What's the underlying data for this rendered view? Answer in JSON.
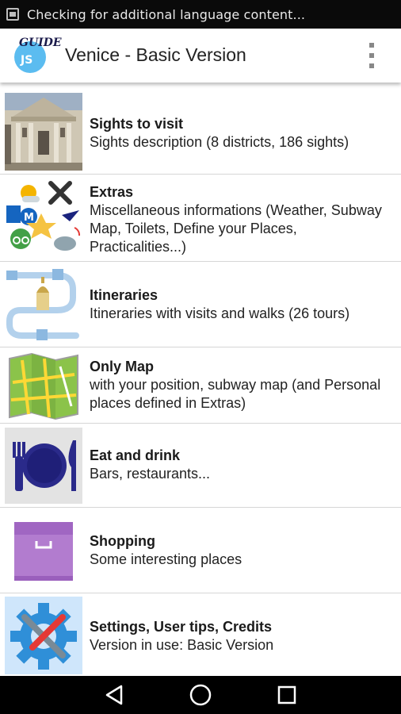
{
  "status_bar": {
    "notification_text": "Checking for additional language content..."
  },
  "app_bar": {
    "logo": {
      "top_text": "GUIDE",
      "bottom_text": "JS"
    },
    "title": "Venice - Basic Version",
    "menu_icon": "overflow-menu-icon"
  },
  "menu": {
    "items": [
      {
        "title": "Sights to visit",
        "desc": "Sights description (8 districts, 186 sights)",
        "icon": "palace-photo"
      },
      {
        "title": "Extras",
        "desc": "Miscellaneous informations (Weather, Subway Map, Toilets, Define your Places, Practicalities...)",
        "icon": "extras-collage-icon"
      },
      {
        "title": "Itineraries",
        "desc": "Itineraries with visits and walks (26 tours)",
        "icon": "itinerary-route-icon"
      },
      {
        "title": "Only Map",
        "desc": "with your position, subway map (and Personal places defined in Extras)",
        "icon": "map-icon"
      },
      {
        "title": "Eat and drink",
        "desc": "Bars, restaurants...",
        "icon": "plate-cutlery-icon"
      },
      {
        "title": "Shopping",
        "desc": "Some interesting places",
        "icon": "shopping-box-icon"
      },
      {
        "title": "Settings, User tips, Credits",
        "desc": "Version in use: Basic Version",
        "icon": "settings-gear-tools-icon"
      }
    ]
  },
  "nav_bar": {
    "buttons": [
      "back-icon",
      "home-icon",
      "recents-icon"
    ]
  },
  "colors": {
    "status_bar_bg": "#0a0a0a",
    "app_bar_bg": "#ffffff",
    "logo_circle": "#5bbcf0",
    "divider": "#d6d6d6",
    "nav_bar_bg": "#000000",
    "plate_navy": "#2a2a8a",
    "shopping_purple": "#b27ccf"
  }
}
